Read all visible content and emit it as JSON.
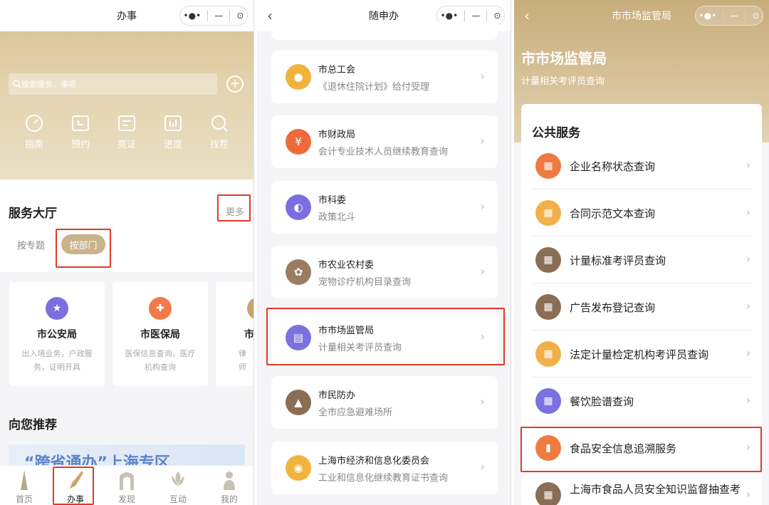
{
  "panel1": {
    "title": "办事",
    "capsule": {
      "menu": "•●•",
      "minimize": "—",
      "close": "⊙"
    },
    "search_placeholder": "搜索服务、事项",
    "quick_actions": [
      {
        "label": "指南",
        "icon": "gauge-icon"
      },
      {
        "label": "预约",
        "icon": "calendar-icon"
      },
      {
        "label": "亮证",
        "icon": "id-card-icon"
      },
      {
        "label": "进度",
        "icon": "chart-icon"
      },
      {
        "label": "找茬",
        "icon": "magnifier-icon"
      }
    ],
    "service_hall": "服务大厅",
    "more": "更多",
    "tabs": [
      "按专题",
      "按部门"
    ],
    "cards": [
      {
        "name": "市公安局",
        "desc": "出入境业务，户政服务，证明开具",
        "color": "#7b6fe0"
      },
      {
        "name": "市医保局",
        "desc": "医保信息查询，医疗机构查询",
        "color": "#f07a4a"
      },
      {
        "name": "市",
        "desc": "律师",
        "color": "#c9a56b"
      }
    ],
    "recommend": "向您推荐",
    "banner": "“跨省通办”上海专区",
    "tabbar": [
      "首页",
      "办事",
      "发现",
      "互动",
      "我的"
    ]
  },
  "panel2": {
    "title": "随申办",
    "items": [
      {
        "title": "市总工会",
        "subtitle": "《退休住院计划》给付受理",
        "color": "#f0b43c"
      },
      {
        "title": "市财政局",
        "subtitle": "会计专业技术人员继续教育查询",
        "color": "#ef6a3a"
      },
      {
        "title": "市科委",
        "subtitle": "政策北斗",
        "color": "#7b6fe0"
      },
      {
        "title": "市农业农村委",
        "subtitle": "宠物诊疗机构目录查询",
        "color": "#9a7d60"
      },
      {
        "title": "市市场监管局",
        "subtitle": "计量相关考评员查询",
        "color": "#7b72e0"
      },
      {
        "title": "市民防办",
        "subtitle": "全市应急避难场所",
        "color": "#8a6d55"
      },
      {
        "title": "上海市经济和信息化委员会",
        "subtitle": "工业和信息化继续教育证书查询",
        "color": "#f0b43c"
      }
    ]
  },
  "panel3": {
    "title": "市市场监管局",
    "heading": "市市场监管局",
    "subheading": "计量相关考评员查询",
    "section": "公共服务",
    "rows": [
      {
        "label": "企业名称状态查询",
        "color": "#ef7a42"
      },
      {
        "label": "合同示范文本查询",
        "color": "#f2b04a"
      },
      {
        "label": "计量标准考评员查询",
        "color": "#8a6d55"
      },
      {
        "label": "广告发布登记查询",
        "color": "#8a6d55"
      },
      {
        "label": "法定计量检定机构考评员查询",
        "color": "#f2b04a"
      },
      {
        "label": "餐饮脸谱查询",
        "color": "#7b72e0"
      },
      {
        "label": "食品安全信息追溯服务",
        "color": "#ef7a42"
      },
      {
        "label": "上海市食品人员安全知识监督抽查考",
        "color": "#8a6d55"
      }
    ]
  },
  "colors": {
    "accent": "#c9b38a",
    "highlight": "#e0392b"
  }
}
